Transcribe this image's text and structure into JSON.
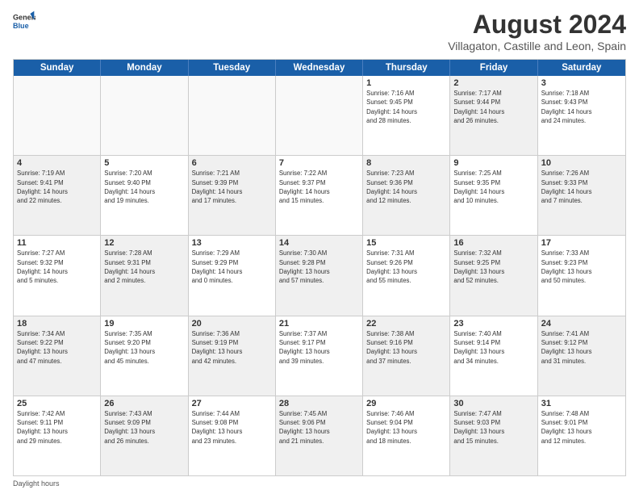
{
  "logo": {
    "line1": "General",
    "line2": "Blue"
  },
  "title": "August 2024",
  "subtitle": "Villagaton, Castille and Leon, Spain",
  "days_of_week": [
    "Sunday",
    "Monday",
    "Tuesday",
    "Wednesday",
    "Thursday",
    "Friday",
    "Saturday"
  ],
  "footer_label": "Daylight hours",
  "weeks": [
    [
      {
        "day": "",
        "info": "",
        "shaded": false,
        "empty": true
      },
      {
        "day": "",
        "info": "",
        "shaded": false,
        "empty": true
      },
      {
        "day": "",
        "info": "",
        "shaded": false,
        "empty": true
      },
      {
        "day": "",
        "info": "",
        "shaded": false,
        "empty": true
      },
      {
        "day": "1",
        "info": "Sunrise: 7:16 AM\nSunset: 9:45 PM\nDaylight: 14 hours\nand 28 minutes.",
        "shaded": false,
        "empty": false
      },
      {
        "day": "2",
        "info": "Sunrise: 7:17 AM\nSunset: 9:44 PM\nDaylight: 14 hours\nand 26 minutes.",
        "shaded": true,
        "empty": false
      },
      {
        "day": "3",
        "info": "Sunrise: 7:18 AM\nSunset: 9:43 PM\nDaylight: 14 hours\nand 24 minutes.",
        "shaded": false,
        "empty": false
      }
    ],
    [
      {
        "day": "4",
        "info": "Sunrise: 7:19 AM\nSunset: 9:41 PM\nDaylight: 14 hours\nand 22 minutes.",
        "shaded": true,
        "empty": false
      },
      {
        "day": "5",
        "info": "Sunrise: 7:20 AM\nSunset: 9:40 PM\nDaylight: 14 hours\nand 19 minutes.",
        "shaded": false,
        "empty": false
      },
      {
        "day": "6",
        "info": "Sunrise: 7:21 AM\nSunset: 9:39 PM\nDaylight: 14 hours\nand 17 minutes.",
        "shaded": true,
        "empty": false
      },
      {
        "day": "7",
        "info": "Sunrise: 7:22 AM\nSunset: 9:37 PM\nDaylight: 14 hours\nand 15 minutes.",
        "shaded": false,
        "empty": false
      },
      {
        "day": "8",
        "info": "Sunrise: 7:23 AM\nSunset: 9:36 PM\nDaylight: 14 hours\nand 12 minutes.",
        "shaded": true,
        "empty": false
      },
      {
        "day": "9",
        "info": "Sunrise: 7:25 AM\nSunset: 9:35 PM\nDaylight: 14 hours\nand 10 minutes.",
        "shaded": false,
        "empty": false
      },
      {
        "day": "10",
        "info": "Sunrise: 7:26 AM\nSunset: 9:33 PM\nDaylight: 14 hours\nand 7 minutes.",
        "shaded": true,
        "empty": false
      }
    ],
    [
      {
        "day": "11",
        "info": "Sunrise: 7:27 AM\nSunset: 9:32 PM\nDaylight: 14 hours\nand 5 minutes.",
        "shaded": false,
        "empty": false
      },
      {
        "day": "12",
        "info": "Sunrise: 7:28 AM\nSunset: 9:31 PM\nDaylight: 14 hours\nand 2 minutes.",
        "shaded": true,
        "empty": false
      },
      {
        "day": "13",
        "info": "Sunrise: 7:29 AM\nSunset: 9:29 PM\nDaylight: 14 hours\nand 0 minutes.",
        "shaded": false,
        "empty": false
      },
      {
        "day": "14",
        "info": "Sunrise: 7:30 AM\nSunset: 9:28 PM\nDaylight: 13 hours\nand 57 minutes.",
        "shaded": true,
        "empty": false
      },
      {
        "day": "15",
        "info": "Sunrise: 7:31 AM\nSunset: 9:26 PM\nDaylight: 13 hours\nand 55 minutes.",
        "shaded": false,
        "empty": false
      },
      {
        "day": "16",
        "info": "Sunrise: 7:32 AM\nSunset: 9:25 PM\nDaylight: 13 hours\nand 52 minutes.",
        "shaded": true,
        "empty": false
      },
      {
        "day": "17",
        "info": "Sunrise: 7:33 AM\nSunset: 9:23 PM\nDaylight: 13 hours\nand 50 minutes.",
        "shaded": false,
        "empty": false
      }
    ],
    [
      {
        "day": "18",
        "info": "Sunrise: 7:34 AM\nSunset: 9:22 PM\nDaylight: 13 hours\nand 47 minutes.",
        "shaded": true,
        "empty": false
      },
      {
        "day": "19",
        "info": "Sunrise: 7:35 AM\nSunset: 9:20 PM\nDaylight: 13 hours\nand 45 minutes.",
        "shaded": false,
        "empty": false
      },
      {
        "day": "20",
        "info": "Sunrise: 7:36 AM\nSunset: 9:19 PM\nDaylight: 13 hours\nand 42 minutes.",
        "shaded": true,
        "empty": false
      },
      {
        "day": "21",
        "info": "Sunrise: 7:37 AM\nSunset: 9:17 PM\nDaylight: 13 hours\nand 39 minutes.",
        "shaded": false,
        "empty": false
      },
      {
        "day": "22",
        "info": "Sunrise: 7:38 AM\nSunset: 9:16 PM\nDaylight: 13 hours\nand 37 minutes.",
        "shaded": true,
        "empty": false
      },
      {
        "day": "23",
        "info": "Sunrise: 7:40 AM\nSunset: 9:14 PM\nDaylight: 13 hours\nand 34 minutes.",
        "shaded": false,
        "empty": false
      },
      {
        "day": "24",
        "info": "Sunrise: 7:41 AM\nSunset: 9:12 PM\nDaylight: 13 hours\nand 31 minutes.",
        "shaded": true,
        "empty": false
      }
    ],
    [
      {
        "day": "25",
        "info": "Sunrise: 7:42 AM\nSunset: 9:11 PM\nDaylight: 13 hours\nand 29 minutes.",
        "shaded": false,
        "empty": false
      },
      {
        "day": "26",
        "info": "Sunrise: 7:43 AM\nSunset: 9:09 PM\nDaylight: 13 hours\nand 26 minutes.",
        "shaded": true,
        "empty": false
      },
      {
        "day": "27",
        "info": "Sunrise: 7:44 AM\nSunset: 9:08 PM\nDaylight: 13 hours\nand 23 minutes.",
        "shaded": false,
        "empty": false
      },
      {
        "day": "28",
        "info": "Sunrise: 7:45 AM\nSunset: 9:06 PM\nDaylight: 13 hours\nand 21 minutes.",
        "shaded": true,
        "empty": false
      },
      {
        "day": "29",
        "info": "Sunrise: 7:46 AM\nSunset: 9:04 PM\nDaylight: 13 hours\nand 18 minutes.",
        "shaded": false,
        "empty": false
      },
      {
        "day": "30",
        "info": "Sunrise: 7:47 AM\nSunset: 9:03 PM\nDaylight: 13 hours\nand 15 minutes.",
        "shaded": true,
        "empty": false
      },
      {
        "day": "31",
        "info": "Sunrise: 7:48 AM\nSunset: 9:01 PM\nDaylight: 13 hours\nand 12 minutes.",
        "shaded": false,
        "empty": false
      }
    ]
  ]
}
